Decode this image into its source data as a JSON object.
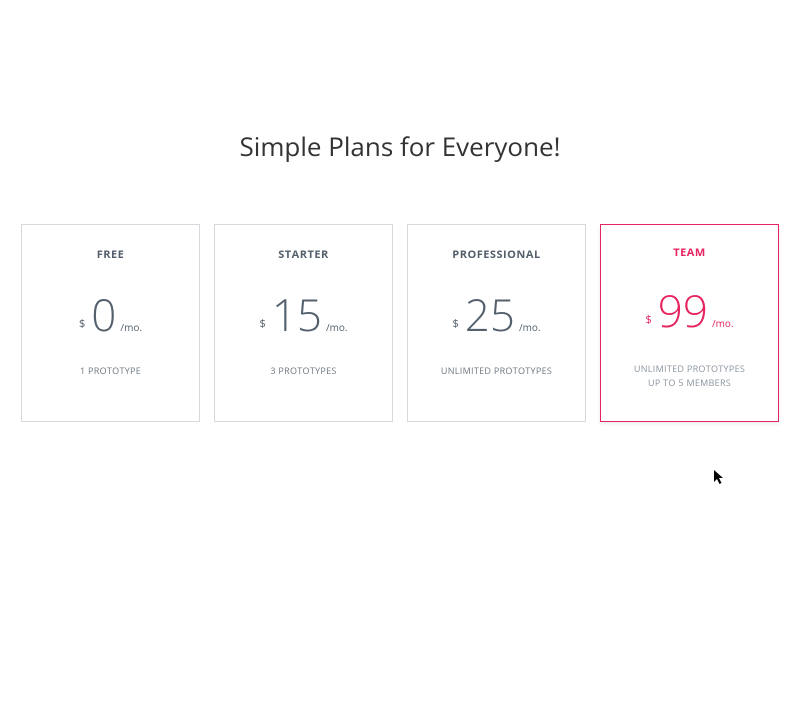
{
  "title": "Simple Plans for Everyone!",
  "currency": "$",
  "period": "/mo.",
  "plans": [
    {
      "name": "FREE",
      "price": "0",
      "feature1": "1 PROTOTYPE",
      "feature2": ""
    },
    {
      "name": "STARTER",
      "price": "15",
      "feature1": "3 PROTOTYPES",
      "feature2": ""
    },
    {
      "name": "PROFESSIONAL",
      "price": "25",
      "feature1": "UNLIMITED PROTOTYPES",
      "feature2": ""
    },
    {
      "name": "TEAM",
      "price": "99",
      "feature1": "UNLIMITED PROTOTYPES",
      "feature2": "UP TO 5 MEMBERS"
    }
  ]
}
